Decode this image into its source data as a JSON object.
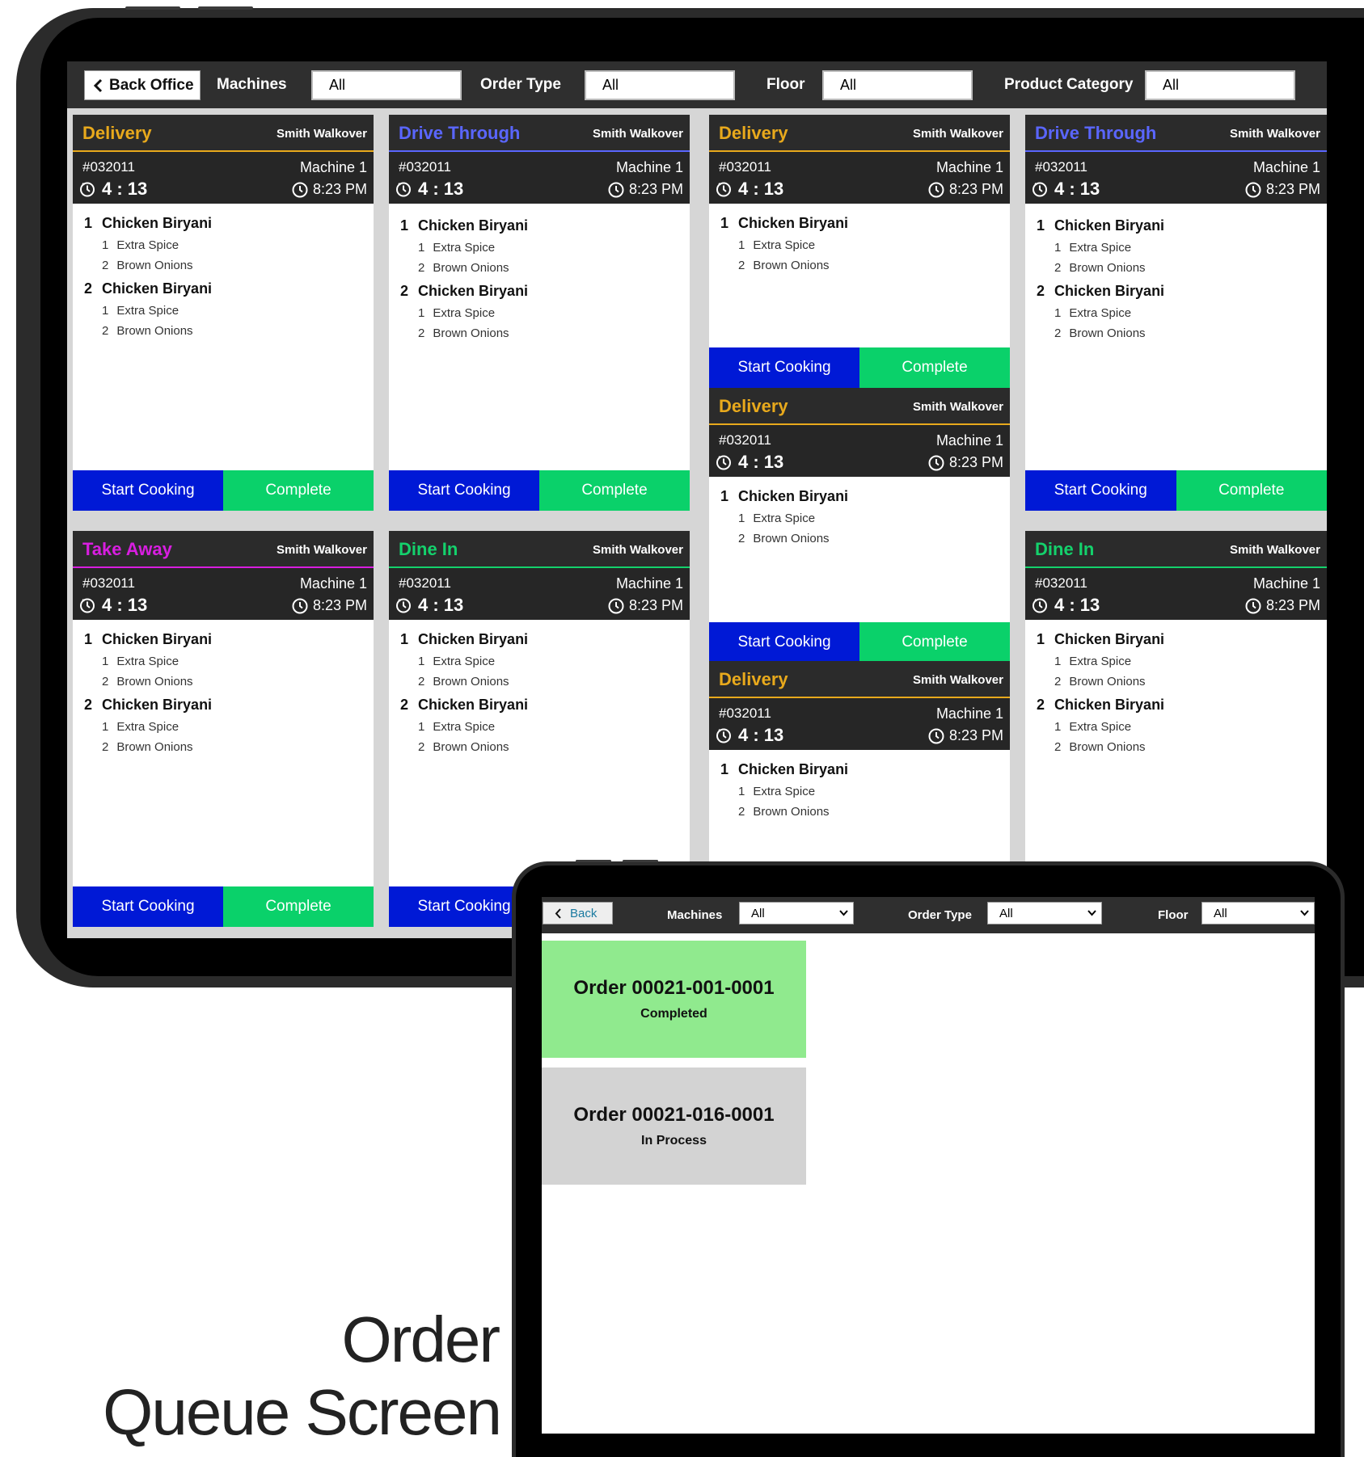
{
  "kds_screen": {
    "toolbar": {
      "back_label": "Back Office",
      "filters": [
        {
          "label": "Machines",
          "value": "All"
        },
        {
          "label": "Order Type",
          "value": "All"
        },
        {
          "label": "Floor",
          "value": "All"
        },
        {
          "label": "Product Category",
          "value": "All"
        }
      ]
    },
    "buttons": {
      "start": "Start Cooking",
      "complete": "Complete"
    },
    "order_cards": [
      {
        "type": "Delivery",
        "type_color": "#e8a91c",
        "customer": "Smith Walkover",
        "order_no": "#032011",
        "machine": "Machine 1",
        "timer": "4 : 13",
        "time": "8:23 PM",
        "items": [
          {
            "qty": "1",
            "name": "Chicken Biryani",
            "mods": [
              {
                "qty": "1",
                "name": "Extra Spice"
              },
              {
                "qty": "2",
                "name": "Brown Onions"
              }
            ]
          },
          {
            "qty": "2",
            "name": "Chicken Biryani",
            "mods": [
              {
                "qty": "1",
                "name": "Extra Spice"
              },
              {
                "qty": "2",
                "name": "Brown Onions"
              }
            ]
          }
        ]
      },
      {
        "type": "Drive Through",
        "type_color": "#5a66ff",
        "customer": "Smith Walkover",
        "order_no": "#032011",
        "machine": "Machine 1",
        "timer": "4 : 13",
        "time": "8:23 PM",
        "items": [
          {
            "qty": "1",
            "name": "Chicken Biryani",
            "mods": [
              {
                "qty": "1",
                "name": "Extra Spice"
              },
              {
                "qty": "2",
                "name": "Brown Onions"
              }
            ]
          },
          {
            "qty": "2",
            "name": "Chicken Biryani",
            "mods": [
              {
                "qty": "1",
                "name": "Extra Spice"
              },
              {
                "qty": "2",
                "name": "Brown Onions"
              }
            ]
          }
        ]
      },
      {
        "type": "Delivery",
        "type_color": "#e8a91c",
        "customer": "Smith Walkover",
        "order_no": "#032011",
        "machine": "Machine 1",
        "timer": "4 : 13",
        "time": "8:23 PM",
        "items": [
          {
            "qty": "1",
            "name": "Chicken Biryani",
            "mods": [
              {
                "qty": "1",
                "name": "Extra Spice"
              },
              {
                "qty": "2",
                "name": "Brown Onions"
              }
            ]
          }
        ]
      },
      {
        "type": "Drive Through",
        "type_color": "#5a66ff",
        "customer": "Smith Walkover",
        "order_no": "#032011",
        "machine": "Machine 1",
        "timer": "4 : 13",
        "time": "8:23 PM",
        "items": [
          {
            "qty": "1",
            "name": "Chicken Biryani",
            "mods": [
              {
                "qty": "1",
                "name": "Extra Spice"
              },
              {
                "qty": "2",
                "name": "Brown Onions"
              }
            ]
          },
          {
            "qty": "2",
            "name": "Chicken Biryani",
            "mods": [
              {
                "qty": "1",
                "name": "Extra Spice"
              },
              {
                "qty": "2",
                "name": "Brown Onions"
              }
            ]
          }
        ]
      },
      {
        "type": "Delivery",
        "type_color": "#e8a91c",
        "customer": "Smith Walkover",
        "order_no": "#032011",
        "machine": "Machine 1",
        "timer": "4 : 13",
        "time": "8:23 PM",
        "items": [
          {
            "qty": "1",
            "name": "Chicken Biryani",
            "mods": [
              {
                "qty": "1",
                "name": "Extra Spice"
              },
              {
                "qty": "2",
                "name": "Brown Onions"
              }
            ]
          }
        ]
      },
      {
        "type": "Take Away",
        "type_color": "#d81ee0",
        "customer": "Smith Walkover",
        "order_no": "#032011",
        "machine": "Machine 1",
        "timer": "4 : 13",
        "time": "8:23 PM",
        "items": [
          {
            "qty": "1",
            "name": "Chicken Biryani",
            "mods": [
              {
                "qty": "1",
                "name": "Extra Spice"
              },
              {
                "qty": "2",
                "name": "Brown Onions"
              }
            ]
          },
          {
            "qty": "2",
            "name": "Chicken Biryani",
            "mods": [
              {
                "qty": "1",
                "name": "Extra Spice"
              },
              {
                "qty": "2",
                "name": "Brown Onions"
              }
            ]
          }
        ]
      },
      {
        "type": "Dine In",
        "type_color": "#14d16c",
        "customer": "Smith Walkover",
        "order_no": "#032011",
        "machine": "Machine 1",
        "timer": "4 : 13",
        "time": "8:23 PM",
        "items": [
          {
            "qty": "1",
            "name": "Chicken Biryani",
            "mods": [
              {
                "qty": "1",
                "name": "Extra Spice"
              },
              {
                "qty": "2",
                "name": "Brown Onions"
              }
            ]
          },
          {
            "qty": "2",
            "name": "Chicken Biryani",
            "mods": [
              {
                "qty": "1",
                "name": "Extra Spice"
              },
              {
                "qty": "2",
                "name": "Brown Onions"
              }
            ]
          }
        ]
      },
      {
        "type": "Delivery",
        "type_color": "#e8a91c",
        "customer": "Smith Walkover",
        "order_no": "#032011",
        "machine": "Machine 1",
        "timer": "4 : 13",
        "time": "8:23 PM",
        "items": [
          {
            "qty": "1",
            "name": "Chicken Biryani",
            "mods": [
              {
                "qty": "1",
                "name": "Extra Spice"
              },
              {
                "qty": "2",
                "name": "Brown Onions"
              }
            ]
          }
        ]
      },
      {
        "type": "Dine In",
        "type_color": "#14d16c",
        "customer": "Smith Walkover",
        "order_no": "#032011",
        "machine": "Machine 1",
        "timer": "4 : 13",
        "time": "8:23 PM",
        "items": [
          {
            "qty": "1",
            "name": "Chicken Biryani",
            "mods": [
              {
                "qty": "1",
                "name": "Extra Spice"
              },
              {
                "qty": "2",
                "name": "Brown Onions"
              }
            ]
          },
          {
            "qty": "2",
            "name": "Chicken Biryani",
            "mods": [
              {
                "qty": "1",
                "name": "Extra Spice"
              },
              {
                "qty": "2",
                "name": "Brown Onions"
              }
            ]
          }
        ]
      }
    ]
  },
  "queue_screen": {
    "toolbar": {
      "back_label": "Back",
      "filters": [
        {
          "label": "Machines",
          "value": "All"
        },
        {
          "label": "Order Type",
          "value": "All"
        },
        {
          "label": "Floor",
          "value": "All"
        }
      ]
    },
    "orders": [
      {
        "name": "Order 00021-001-0001",
        "status": "Completed",
        "color": "#90ea8e"
      },
      {
        "name": "Order 00021-016-0001",
        "status": "In Process",
        "color": "#d3d3d3"
      }
    ]
  },
  "caption": {
    "line1": "Order",
    "line2": "Queue Screen"
  },
  "icons": {
    "back": "chevron-left-icon",
    "timer": "timer-icon",
    "clock": "clock-icon",
    "dropdown": "chevron-down-icon"
  }
}
